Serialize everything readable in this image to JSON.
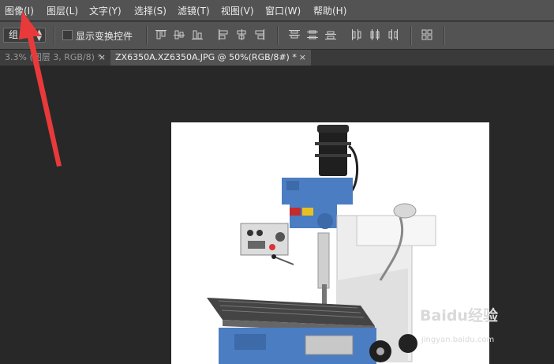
{
  "menubar": {
    "items": [
      {
        "label": "图像(I)"
      },
      {
        "label": "图层(L)"
      },
      {
        "label": "文字(Y)"
      },
      {
        "label": "选择(S)"
      },
      {
        "label": "滤镜(T)"
      },
      {
        "label": "视图(V)"
      },
      {
        "label": "窗口(W)"
      },
      {
        "label": "帮助(H)"
      }
    ]
  },
  "options_bar": {
    "auto_select_value": "组",
    "show_transform_controls_label": "显示变换控件",
    "show_transform_controls_checked": false,
    "icons": [
      "align-top-icon",
      "align-vcenter-icon",
      "align-bottom-icon",
      "align-left-icon",
      "align-hcenter-icon",
      "align-right-icon",
      "distribute-top-icon",
      "distribute-vcenter-icon",
      "distribute-bottom-icon",
      "distribute-left-icon",
      "distribute-hcenter-icon",
      "distribute-right-icon",
      "auto-align-icon"
    ]
  },
  "tabs": [
    {
      "label": "3.3% (图层 3, RGB/8) *",
      "active": false,
      "close": "×"
    },
    {
      "label": "ZX6350A.XZ6350A.JPG @ 50%(RGB/8#) *",
      "active": true,
      "close": "×"
    }
  ],
  "canvas": {
    "image_subject": "milling-machine-image",
    "annotation_arrow_color": "#e83a3a"
  },
  "watermark": {
    "logo": "Baidu经验",
    "url": "jingyan.baidu.com"
  },
  "colors": {
    "menubar_bg": "#535353",
    "workspace_bg": "#282828",
    "tab_active_bg": "#535353",
    "arrow": "#e83a3a"
  }
}
